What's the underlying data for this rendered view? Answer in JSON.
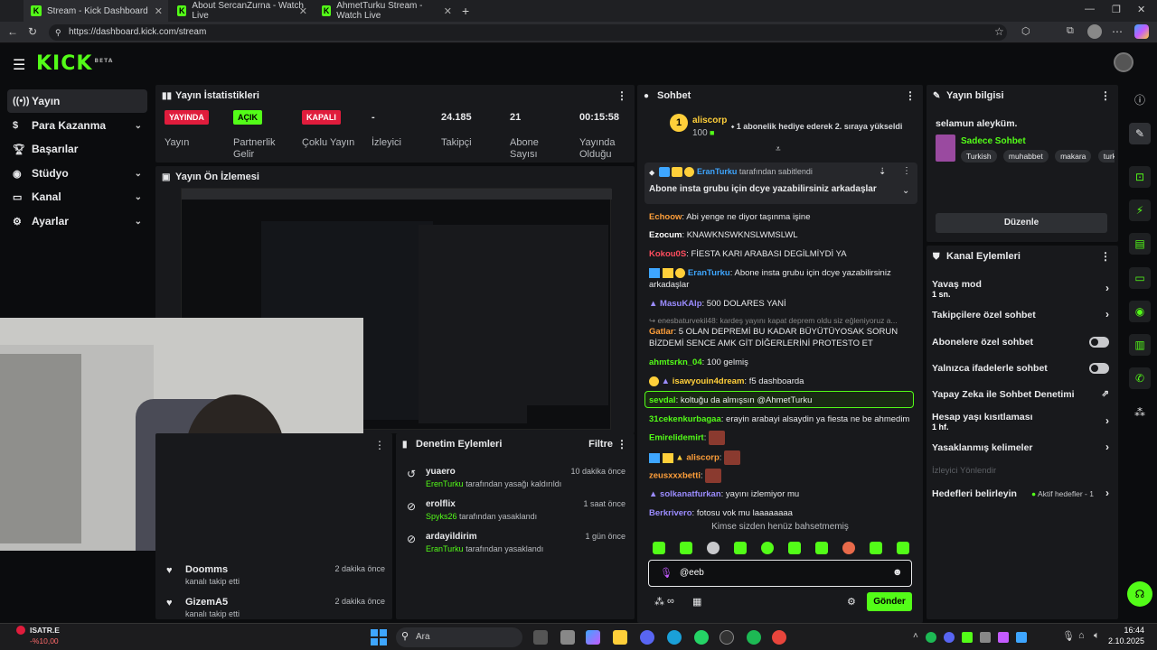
{
  "browser": {
    "tabs": [
      {
        "title": "Stream - Kick Dashboard",
        "active": true
      },
      {
        "title": "About SercanZurna - Watch Live",
        "active": false
      },
      {
        "title": "AhmetTurku Stream - Watch Live",
        "active": false
      }
    ],
    "url": "https://dashboard.kick.com/stream"
  },
  "header": {
    "logo": "KICK",
    "logo_tag": "BETA"
  },
  "sidebar": {
    "items": [
      {
        "label": "Yayın",
        "icon": "stream-icon",
        "active": true
      },
      {
        "label": "Para Kazanma",
        "icon": "money-icon",
        "expandable": true
      },
      {
        "label": "Başarılar",
        "icon": "trophy-icon"
      },
      {
        "label": "Stüdyo",
        "icon": "studio-icon",
        "expandable": true
      },
      {
        "label": "Kanal",
        "icon": "channel-icon",
        "expandable": true
      },
      {
        "label": "Ayarlar",
        "icon": "gear-icon",
        "expandable": true
      }
    ]
  },
  "stats": {
    "title": "Yayın İstatistikleri",
    "items": [
      {
        "badge": "YAYINDA",
        "label": "Yayın",
        "color": "#e01c3c"
      },
      {
        "badge": "AÇIK",
        "label": "Partnerlik Gelir",
        "color": "#53fc18"
      },
      {
        "badge": "KAPALI",
        "label": "Çoklu Yayın",
        "color": "#e01c3c"
      },
      {
        "value": "-",
        "label": "İzleyici"
      },
      {
        "value": "24.185",
        "label": "Takipçi"
      },
      {
        "value": "21",
        "label": "Abone Sayısı"
      },
      {
        "value": "00:15:58",
        "label": "Yayında Olduğu"
      }
    ]
  },
  "preview": {
    "title": "Yayın Ön İzlemesi"
  },
  "follows": [
    {
      "user": "Doomms",
      "action": "kanalı takip etti",
      "time": "2 dakika önce"
    },
    {
      "user": "GizemA5",
      "action": "kanalı takip etti",
      "time": "2 dakika önce"
    }
  ],
  "moderation": {
    "title": "Denetim Eylemleri",
    "filter": "Filtre",
    "items": [
      {
        "user": "yuaero",
        "by": "ErenTurku",
        "action": "tarafından yasağı kaldırıldı",
        "time": "10 dakika önce"
      },
      {
        "user": "erolflix",
        "by": "Spyks26",
        "action": "tarafından yasaklandı",
        "time": "1 saat önce"
      },
      {
        "user": "ardayildirim",
        "by": "EranTurku",
        "action": "tarafından yasaklandı",
        "time": "1 gün önce"
      }
    ]
  },
  "chat": {
    "title": "Sohbet",
    "gift_user": "aliscorp",
    "gift_count": "100",
    "gift_text": "1 abonelik hediye ederek 2. sıraya yükseldi",
    "pinned_by": "EranTurku",
    "pinned_suffix": "tarafından sabitlendi",
    "pinned_text": "Abone insta grubu için dcye yazabilirsiniz arkadaşlar",
    "messages": [
      {
        "user": "Echoow",
        "text": "Abi yenge ne diyor taşınma işine",
        "color": "#ff9f3a"
      },
      {
        "user": "Ezocum",
        "text": "KNAWKNSWKNSLWMSLWL",
        "color": "#ffffff"
      },
      {
        "user": "Kokou0S",
        "text": "FİESTA KARI ARABASI DEGİLMİYDİ YA",
        "color": "#ff4d5e"
      },
      {
        "user": "EranTurku",
        "text": "Abone insta grubu için dcye yazabilirsiniz",
        "cont": "arkadaşlar",
        "color": "#3ea6ff"
      },
      {
        "user": "MasuKAlp",
        "text": "500 DOLARES YANİ",
        "color": "#9b8cff"
      },
      {
        "user": "enesbaturvekil48",
        "text": "kardeş yayını kapat deprem oldu siz eğleniyoruz a...",
        "color": "#888888"
      },
      {
        "user": "Gatlar",
        "text": "5 OLAN DEPREMİ BU KADAR BÜYÜTÜYOSAK SORUN",
        "cont": "BİZDEMİ SENCE AMK GİT DİĞERLERİNİ PROTESTO ET",
        "color": "#ff9f3a"
      },
      {
        "user": "ahmtsrkn_04",
        "text": "100 gelmiş",
        "color": "#53fc18"
      },
      {
        "user": "isawyouin4dream",
        "text": "f5 dashboarda",
        "color": "#ffcf3a"
      },
      {
        "user": "sevdal",
        "text": "koltuğu da almışsın @AhmetTurku",
        "color": "#53fc18"
      },
      {
        "user": "31cekenkurbagaa",
        "text": "erayin arabayi alsaydin ya fiesta ne be ahmedim",
        "color": "#53fc18"
      },
      {
        "user": "Emirelidemirt",
        "text": "",
        "color": "#53fc18"
      },
      {
        "user": "aliscorp",
        "text": "",
        "color": "#ff9f3a"
      },
      {
        "user": "zeusxxxbetti",
        "text": "",
        "color": "#ff9f3a"
      },
      {
        "user": "solkanatfurkan",
        "text": "yayını izlemiyor mu",
        "color": "#9b8cff"
      },
      {
        "user": "Berkrivero",
        "text": "fotosu vok mu laaaaaaaa",
        "color": "#9b8cff"
      }
    ],
    "mention_notice": "Kimse sizden henüz bahsetmemiş",
    "input_value": "@eeb",
    "send": "Gönder"
  },
  "stream_info": {
    "title": "Yayın bilgisi",
    "stream_title": "selamun aleyküm.",
    "category": "Sadece Sohbet",
    "tags": [
      "Turkish",
      "muhabbet",
      "makara",
      "turk"
    ],
    "edit": "Düzenle"
  },
  "channel_actions": {
    "title": "Kanal Eylemleri",
    "items": [
      {
        "label": "Yavaş mod",
        "sub": "1 sn.",
        "kind": "chevron"
      },
      {
        "label": "Takipçilere özel sohbet",
        "kind": "chevron"
      },
      {
        "label": "Abonelere özel sohbet",
        "kind": "toggle"
      },
      {
        "label": "Yalnızca ifadelerle sohbet",
        "kind": "toggle"
      },
      {
        "label": "Yapay Zeka ile Sohbet Denetimi",
        "kind": "external"
      },
      {
        "label": "Hesap yaşı kısıtlaması",
        "sub": "1 hf.",
        "kind": "chevron"
      },
      {
        "label": "Yasaklanmış kelimeler",
        "kind": "chevron"
      },
      {
        "label": "İzleyici Yönlendir",
        "kind": "disabled"
      },
      {
        "label": "Hedefleri belirleyin",
        "kind": "goal",
        "goal": "Aktif hedefler - 1"
      }
    ]
  },
  "taskbar": {
    "ticker": "ISATR.E",
    "ticker_change": "-%10,00",
    "search": "Ara",
    "time": "16:44",
    "date": "2.10.2025"
  }
}
